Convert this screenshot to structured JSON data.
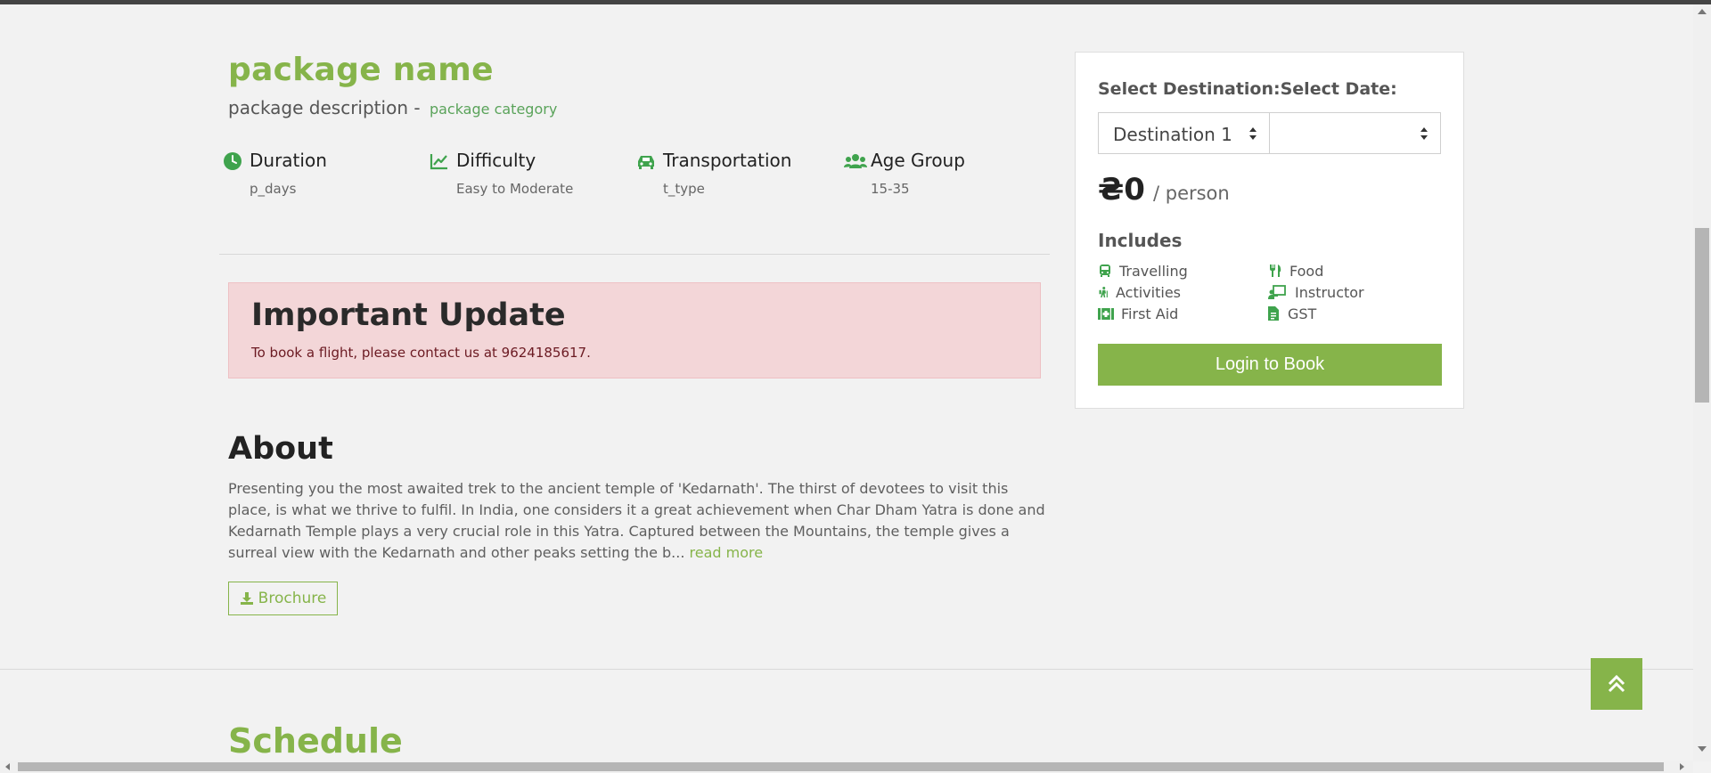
{
  "package": {
    "name": "package name",
    "description": "package description - ",
    "category": "package category"
  },
  "facts": [
    {
      "icon": "clock-icon",
      "title": "Duration",
      "value": "p_days"
    },
    {
      "icon": "chart-line-icon",
      "title": "Difficulty",
      "value": "Easy to Moderate"
    },
    {
      "icon": "car-icon",
      "title": "Transportation",
      "value": "t_type"
    },
    {
      "icon": "users-icon",
      "title": "Age Group",
      "value": "15-35"
    }
  ],
  "alert": {
    "title": "Important Update",
    "text": "To book a flight, please contact us at 9624185617."
  },
  "about": {
    "heading": "About",
    "text": "Presenting you the most awaited trek to the ancient temple of 'Kedarnath'. The thirst of devotees to visit this place, is what we thrive to fulfil. In India, one considers it a great achievement when Char Dham Yatra is done and Kedarnath Temple plays a very crucial role in this Yatra. Captured between the Mountains, the temple gives a surreal view with the Kedarnath and other peaks setting the b...",
    "read_more": "read more",
    "brochure_label": "Brochure"
  },
  "schedule": {
    "heading": "Schedule"
  },
  "booking": {
    "select_label": "Select Destination:Select Date:",
    "destination_value": "Destination 1",
    "date_value": "",
    "price": "₴0",
    "per": "/ person",
    "includes_heading": "Includes",
    "includes": [
      {
        "icon": "bus-icon",
        "label": "Travelling"
      },
      {
        "icon": "utensils-icon",
        "label": "Food"
      },
      {
        "icon": "hiking-icon",
        "label": "Activities"
      },
      {
        "icon": "chalkboard-teacher-icon",
        "label": "Instructor"
      },
      {
        "icon": "first-aid-icon",
        "label": "First Aid"
      },
      {
        "icon": "file-invoice-icon",
        "label": "GST"
      }
    ],
    "login_label": "Login to Book"
  },
  "colors": {
    "accent": "#86b44a",
    "alert_bg": "#f3d6d8",
    "alert_text": "#6b1a22",
    "background": "#f2f2f2"
  }
}
